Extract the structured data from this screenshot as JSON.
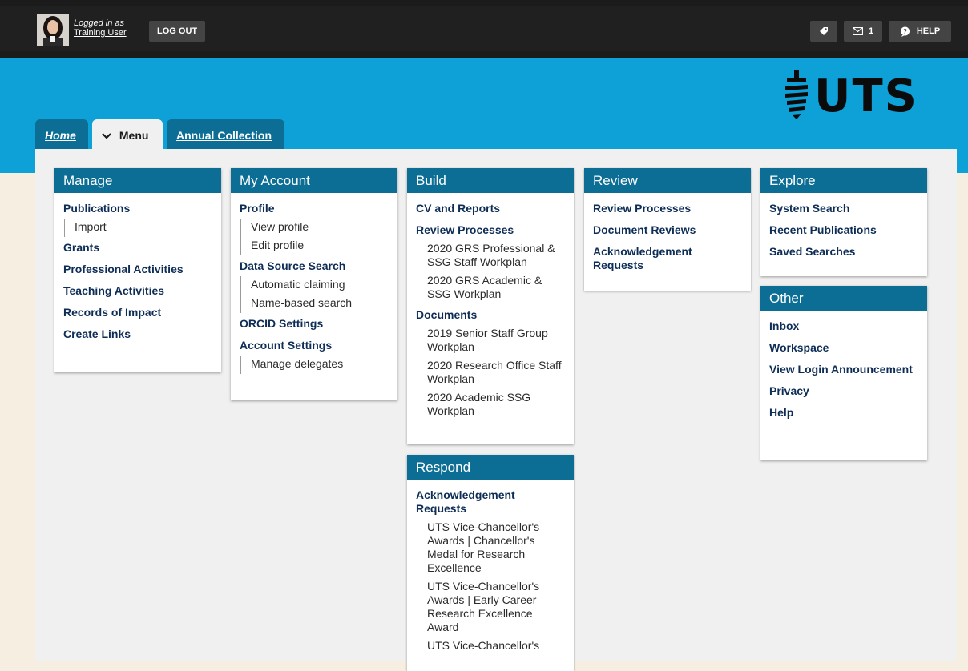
{
  "header": {
    "logged_in_label": "Logged in as",
    "user_name": "Training User",
    "logout_label": "LOG OUT",
    "message_count": "1",
    "help_label": "HELP"
  },
  "brand": {
    "logo_text": "UTS"
  },
  "tabs": [
    {
      "label": "Home"
    },
    {
      "label": "Menu"
    },
    {
      "label": "Annual Collection"
    }
  ],
  "menu": {
    "manage": {
      "title": "Manage",
      "items": [
        "Publications",
        "Import",
        "Grants",
        "Professional Activities",
        "Teaching Activities",
        "Records of Impact",
        "Create Links"
      ]
    },
    "account": {
      "title": "My Account",
      "items": [
        "Profile",
        "View profile",
        "Edit profile",
        "Data Source Search",
        "Automatic claiming",
        "Name-based search",
        "ORCID Settings",
        "Account Settings",
        "Manage delegates"
      ]
    },
    "build": {
      "title": "Build",
      "items": [
        "CV and Reports",
        "Review Processes",
        "2020 GRS Professional & SSG Staff Workplan",
        "2020 GRS Academic & SSG Workplan",
        "Documents",
        "2019 Senior Staff Group Workplan",
        "2020 Research Office Staff Workplan",
        "2020 Academic SSG Workplan"
      ]
    },
    "respond": {
      "title": "Respond",
      "items": [
        "Acknowledgement Requests",
        "UTS Vice-Chancellor's Awards | Chancellor's Medal for Research Excellence",
        "UTS Vice-Chancellor's Awards | Early Career Research Excellence Award",
        "UTS Vice-Chancellor's"
      ]
    },
    "review": {
      "title": "Review",
      "items": [
        "Review Processes",
        "Document Reviews",
        "Acknowledgement Requests"
      ]
    },
    "explore": {
      "title": "Explore",
      "items": [
        "System Search",
        "Recent Publications",
        "Saved Searches"
      ]
    },
    "other": {
      "title": "Other",
      "items": [
        "Inbox",
        "Workspace",
        "View Login Announcement",
        "Privacy",
        "Help"
      ]
    }
  }
}
